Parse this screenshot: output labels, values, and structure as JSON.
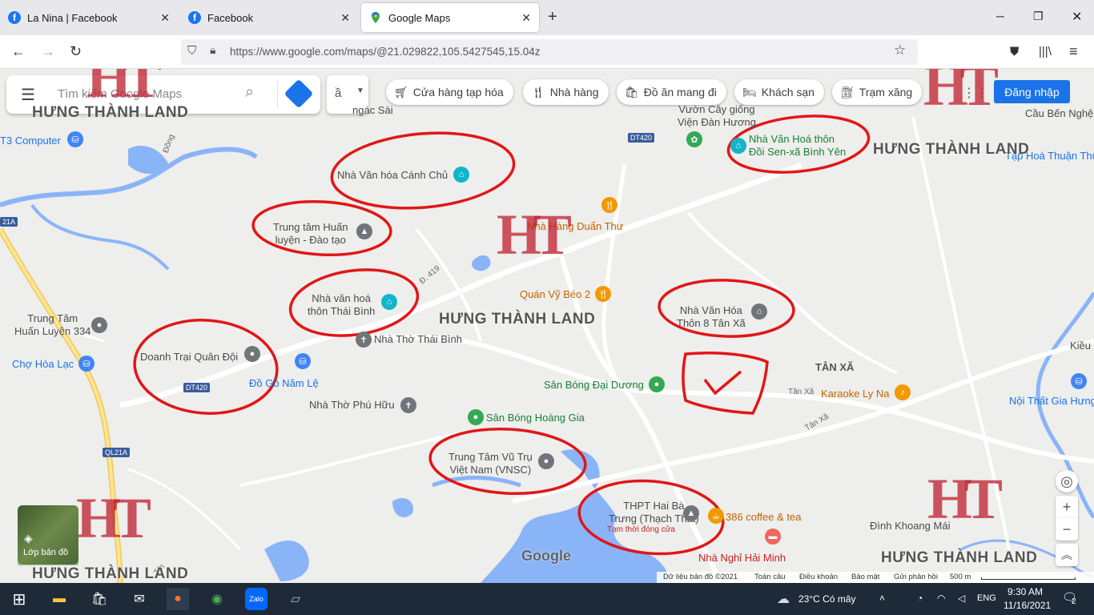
{
  "browser": {
    "tabs": [
      {
        "label": "La Nina | Facebook",
        "icon": "facebook-icon"
      },
      {
        "label": "Facebook",
        "icon": "facebook-icon"
      },
      {
        "label": "Google Maps",
        "icon": "google-maps-icon",
        "active": true
      }
    ],
    "url": "https://www.google.com/maps/@21.029822,105.5427545,15.04z"
  },
  "maps": {
    "search_placeholder": "Tìm kiếm Google Maps",
    "lang_label": "ầ",
    "chips": [
      {
        "icon": "cart-icon",
        "label": "Cửa hàng tạp hóa"
      },
      {
        "icon": "restaurant-icon",
        "label": "Nhà hàng"
      },
      {
        "icon": "takeout-icon",
        "label": "Đồ ăn mang đi"
      },
      {
        "icon": "hotel-icon",
        "label": "Khách sạn"
      },
      {
        "icon": "gas-icon",
        "label": "Trạm xăng"
      }
    ],
    "signin": "Đăng nhập",
    "layers_label": "Lớp bản đồ",
    "google_logo": "Google",
    "footer": [
      "Dữ liệu bản đồ ©2021",
      "Toàn cầu",
      "Điều khoản",
      "Bảo mật",
      "Gửi phản hồi",
      "500 m"
    ]
  },
  "places": [
    "Nhà Văn hóa Cánh Chủ",
    "Trung tâm Huấn\nluyện - Đào tạo",
    "Nhà văn hoá\nthôn Thái Bình",
    "Nhà Thờ Thái Bình",
    "Doanh Trại Quân Đội",
    "Đồ Gỗ Năm Lệ",
    "Nhà Thờ Phú Hữu",
    "Sân Bóng Hoàng Gia",
    "Trung Tâm Vũ Trụ\nViệt Nam (VNSC)",
    "THPT Hai Bà\nTrưng (Thạch Thất)",
    "Tạm thời đóng cửa",
    "386 coffee & tea",
    "Nhà Nghỉ Hải Minh",
    "Sân Bóng Đại Dương",
    "Nhà Văn Hóa\nThôn 8 Tân Xã",
    "TÂN XÃ",
    "Karaoke Ly Na",
    "Nội Thất Gia Hưng",
    "Đình Khoang Mái",
    "Nhà Hàng Duẩn Thư",
    "Quán Vỹ Béo 2",
    "Vườn Cây giống\nViện Đàn Hương",
    "Nhà Văn Hoá thôn\nĐồi Sen-xã Bình Yên",
    "Tạp Hoá Thuận Thủy",
    "Cầu Bến Nghệ",
    "T3 Computer",
    "Trung Tâm\nHuấn Luyện 334",
    "Chợ Hòa Lạc",
    "Kiều",
    "ngác Sài"
  ],
  "roads": [
    "DT420",
    "DT420",
    "Đ. 419",
    "QL21A",
    "21A",
    "Tân Xã",
    "Tân Xã",
    "Đồng",
    "Tín"
  ],
  "watermark": {
    "brand": "HƯNG THÀNH LAND",
    "logo_letters": "HT"
  },
  "taskbar": {
    "weather": "23°C  Có mây",
    "lang": "ENG",
    "time": "9:30 AM",
    "date": "11/16/2021",
    "notifications": "2"
  }
}
